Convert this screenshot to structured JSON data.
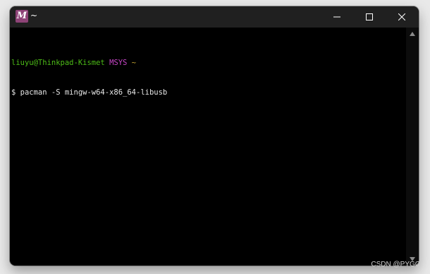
{
  "window": {
    "icon_letter": "M",
    "title": "~",
    "icon": "msys2-logo",
    "controls": {
      "minimize": "minimize-icon",
      "maximize": "maximize-icon",
      "close": "close-icon"
    }
  },
  "terminal": {
    "prompt": {
      "user_host": "liuyu@Thinkpad-Kismet",
      "env": "MSYS",
      "dir": "~"
    },
    "command_line": "$ pacman -S mingw-w64-x86_64-libusb"
  },
  "watermark": "CSDN @PYGC",
  "colors": {
    "titlebar": "#202020",
    "background": "#000000",
    "prompt_user": "#4cbb17",
    "prompt_env": "#c846c8",
    "prompt_dir": "#c8a632",
    "icon_bg": "#8e4377"
  }
}
